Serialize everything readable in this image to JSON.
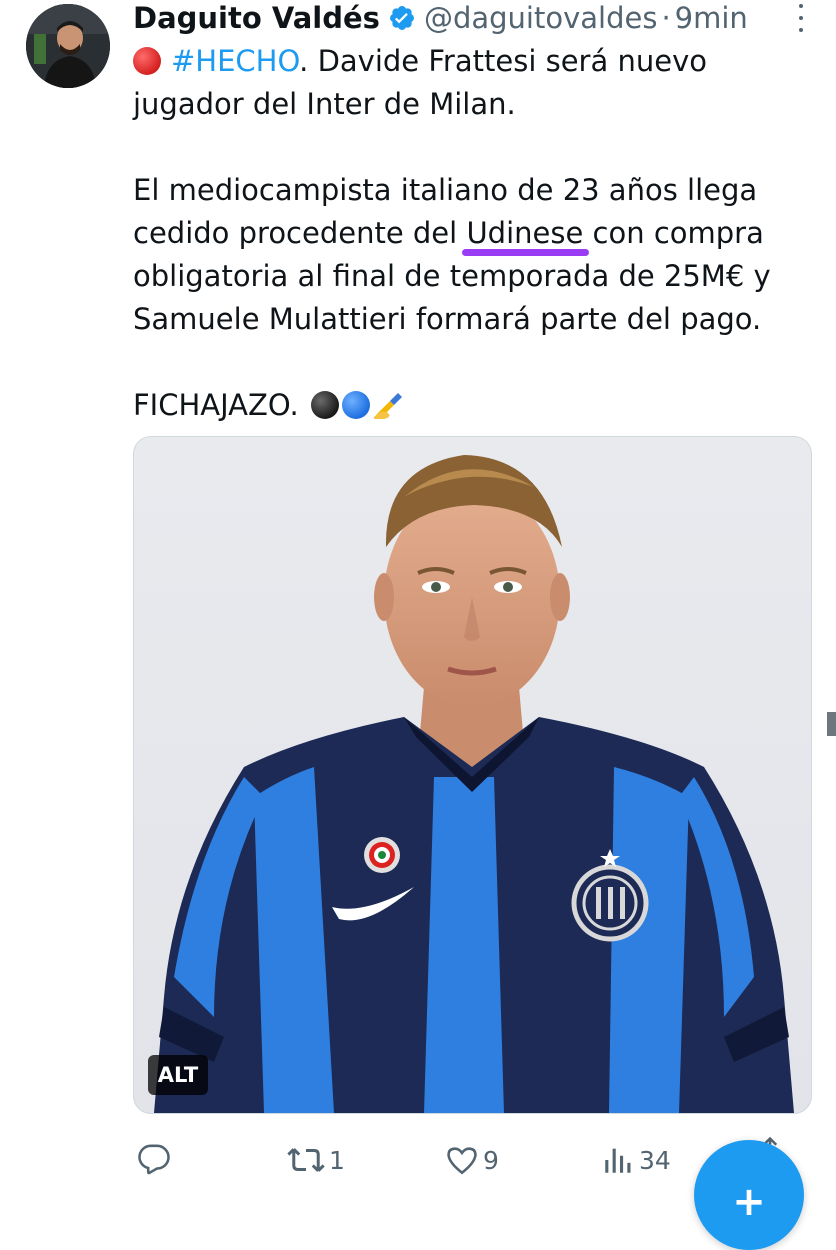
{
  "tweet": {
    "author_name": "Daguito Valdés",
    "handle": "@daguitovaldes",
    "separator": "·",
    "time": "9min",
    "hashtag": "#HECHO",
    "line1_rest": ". Davide Frattesi será nuevo jugador del Inter de Milan.",
    "para2_before": "El mediocampista italiano de 23 años llega cedido procedente del ",
    "para2_highlight": "Udinese",
    "para2_after": " con compra obligatoria al final de temporada de 25M€ y Samuele Mulattieri formará parte del pago.",
    "para3": "FICHAJAZO.",
    "media_alt_badge": "ALT"
  },
  "actions": {
    "reply_count": "",
    "retweet_count": "1",
    "like_count": "9",
    "views_count": "34"
  },
  "icons": {
    "verified": "verified-badge-icon",
    "more": "more-vertical-icon",
    "reply": "reply-icon",
    "retweet": "retweet-icon",
    "like": "heart-icon",
    "views": "views-chart-icon",
    "share": "share-icon",
    "compose": "plus-icon"
  },
  "colors": {
    "accent": "#1d9bf0",
    "text": "#0f1419",
    "secondary": "#536471",
    "highlight_underline": "#9b3cf5",
    "emoji_red": "#d42020",
    "emoji_black": "#1a1a1a",
    "emoji_blue": "#1e6fe0"
  },
  "compose_button": {
    "label": "+"
  }
}
